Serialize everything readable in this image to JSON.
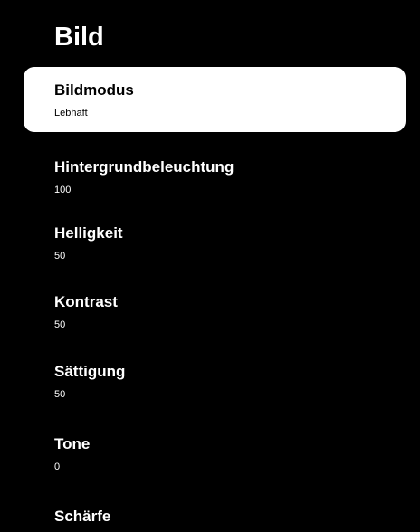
{
  "menu": {
    "title": "Bild",
    "items": [
      {
        "label": "Bildmodus",
        "value": "Lebhaft"
      },
      {
        "label": "Hintergrundbeleuchtung",
        "value": "100"
      },
      {
        "label": "Helligkeit",
        "value": "50"
      },
      {
        "label": "Kontrast",
        "value": "50"
      },
      {
        "label": "Sättigung",
        "value": "50"
      },
      {
        "label": "Tone",
        "value": "0"
      },
      {
        "label": "Schärfe",
        "value": ""
      }
    ]
  }
}
